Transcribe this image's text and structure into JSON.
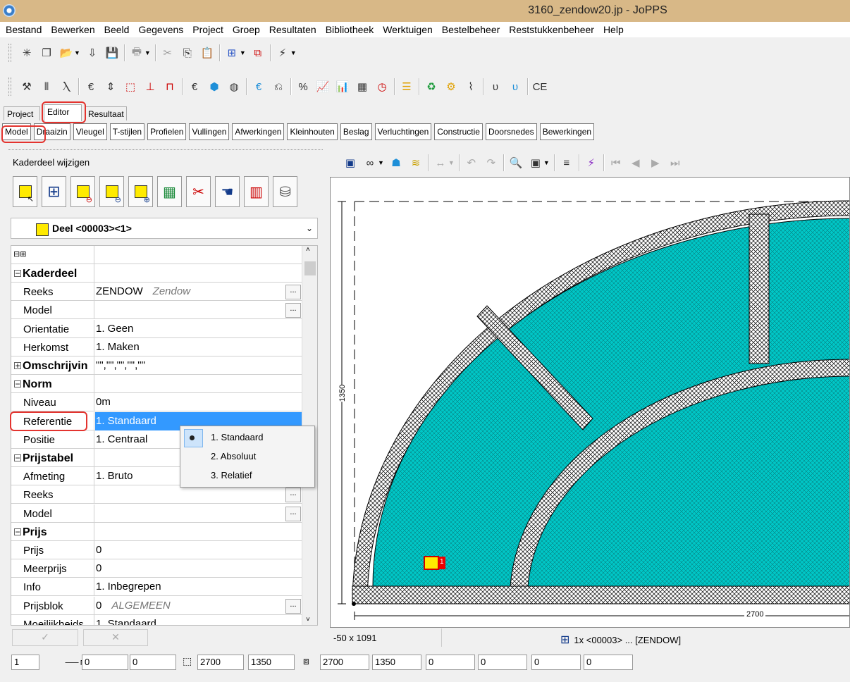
{
  "window": {
    "title": "3160_zendow20.jp - JoPPS"
  },
  "menu": [
    "Bestand",
    "Bewerken",
    "Beeld",
    "Gegevens",
    "Project",
    "Groep",
    "Resultaten",
    "Bibliotheek",
    "Werktuigen",
    "Bestelbeheer",
    "Reststukkenbeheer",
    "Help"
  ],
  "main_tabs": [
    "Project",
    "Editor",
    "Resultaat"
  ],
  "sub_tabs": [
    "Model",
    "Draaizin",
    "Vleugel",
    "T-stijlen",
    "Profielen",
    "Vullingen",
    "Afwerkingen",
    "Kleinhouten",
    "Beslag",
    "Verluchtingen",
    "Constructie",
    "Doorsnedes",
    "Bewerkingen"
  ],
  "left_panel": {
    "title": "Kaderdeel wijzigen",
    "part_select": "Deel <00003><1>"
  },
  "properties": [
    {
      "name": "Kaderdeel",
      "cat": true
    },
    {
      "name": "Reeks",
      "value": "ZENDOW",
      "sub": "Zendow",
      "btn": true
    },
    {
      "name": "Model",
      "value": "",
      "btn": true
    },
    {
      "name": "Orientatie",
      "value": "1. Geen"
    },
    {
      "name": "Herkomst",
      "value": "1. Maken"
    },
    {
      "name": "Omschrijvin",
      "value": "\"\",\"\",\"\",\"\",\"\"",
      "cat": true,
      "plus": true
    },
    {
      "name": "Norm",
      "cat": true
    },
    {
      "name": "Niveau",
      "value": "0m"
    },
    {
      "name": "Referentie",
      "value": "1. Standaard",
      "selected": true
    },
    {
      "name": "Positie",
      "value": "1. Centraal"
    },
    {
      "name": "Prijstabel",
      "cat": true
    },
    {
      "name": "Afmeting",
      "value": "1. Bruto"
    },
    {
      "name": "Reeks",
      "value": "",
      "btn": true
    },
    {
      "name": "Model",
      "value": "",
      "btn": true
    },
    {
      "name": "Prijs",
      "cat": true
    },
    {
      "name": "Prijs",
      "value": "0"
    },
    {
      "name": "Meerprijs",
      "value": "0"
    },
    {
      "name": "Info",
      "value": "1. Inbegrepen"
    },
    {
      "name": "Prijsblok",
      "value": "0",
      "sub": "ALGEMEEN",
      "btn": true
    },
    {
      "name": "Moeilijkheids",
      "value": "1. Standaard"
    }
  ],
  "dropdown": [
    "1. Standaard",
    "2. Absoluut",
    "3. Relatief"
  ],
  "drawing": {
    "dim_height": "1350",
    "dim_width": "2700",
    "part_label": "1"
  },
  "status": {
    "coords": "-50 x 1091",
    "selection": "1x <00003> ... [ZENDOW]"
  },
  "bottom_inputs": {
    "index": "1",
    "a": "0",
    "b": "0",
    "w1": "2700",
    "h1": "1350",
    "w2": "2700",
    "h2": "1350",
    "c": "0",
    "d": "0",
    "e": "0",
    "f": "0"
  },
  "colors": {
    "glass": "#00c8c8",
    "accent_ring": "#e3342f",
    "selection": "#3399ff",
    "part": "#ffea00"
  }
}
